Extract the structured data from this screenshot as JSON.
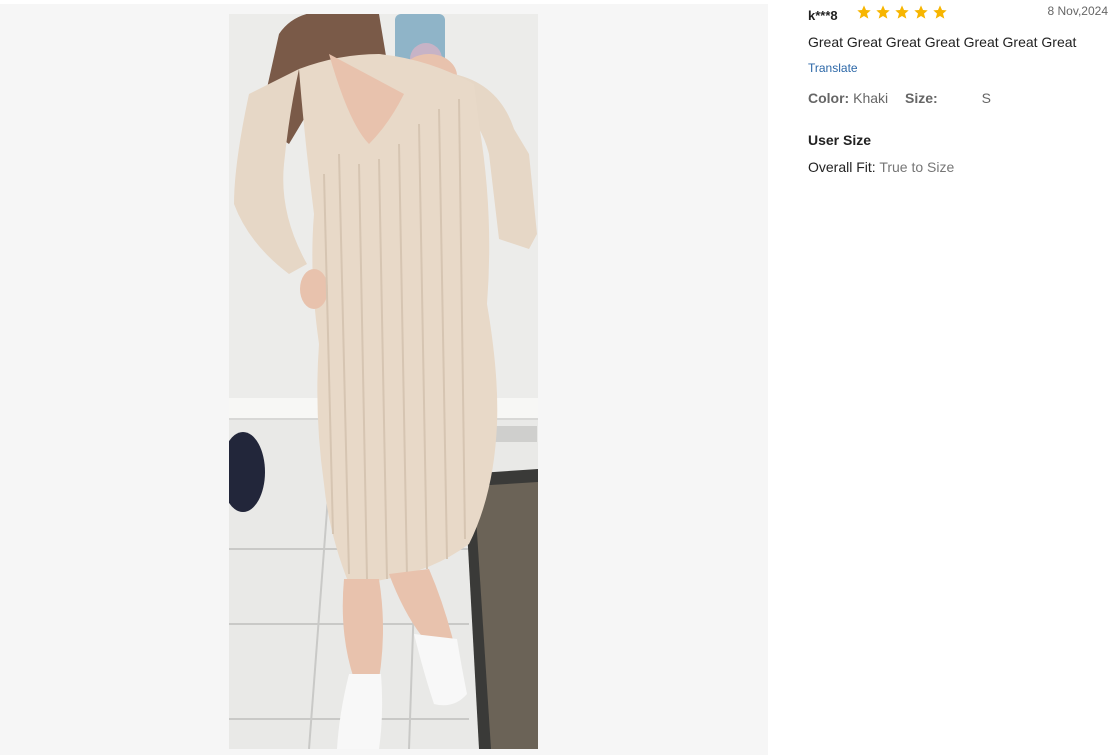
{
  "review": {
    "username": "k***8",
    "rating": 5,
    "rating_max": 5,
    "star_color": "#f7b500",
    "date": "8 Nov,2024",
    "text": "Great Great Great Great Great Great Great",
    "translate_label": "Translate",
    "color_label": "Color:",
    "color_value": "Khaki",
    "size_label": "Size:",
    "size_value": "S",
    "user_size_title": "User Size",
    "overall_fit_label": "Overall Fit:",
    "overall_fit_value": "True to Size"
  },
  "photo": {
    "subject": "customer-photo"
  }
}
